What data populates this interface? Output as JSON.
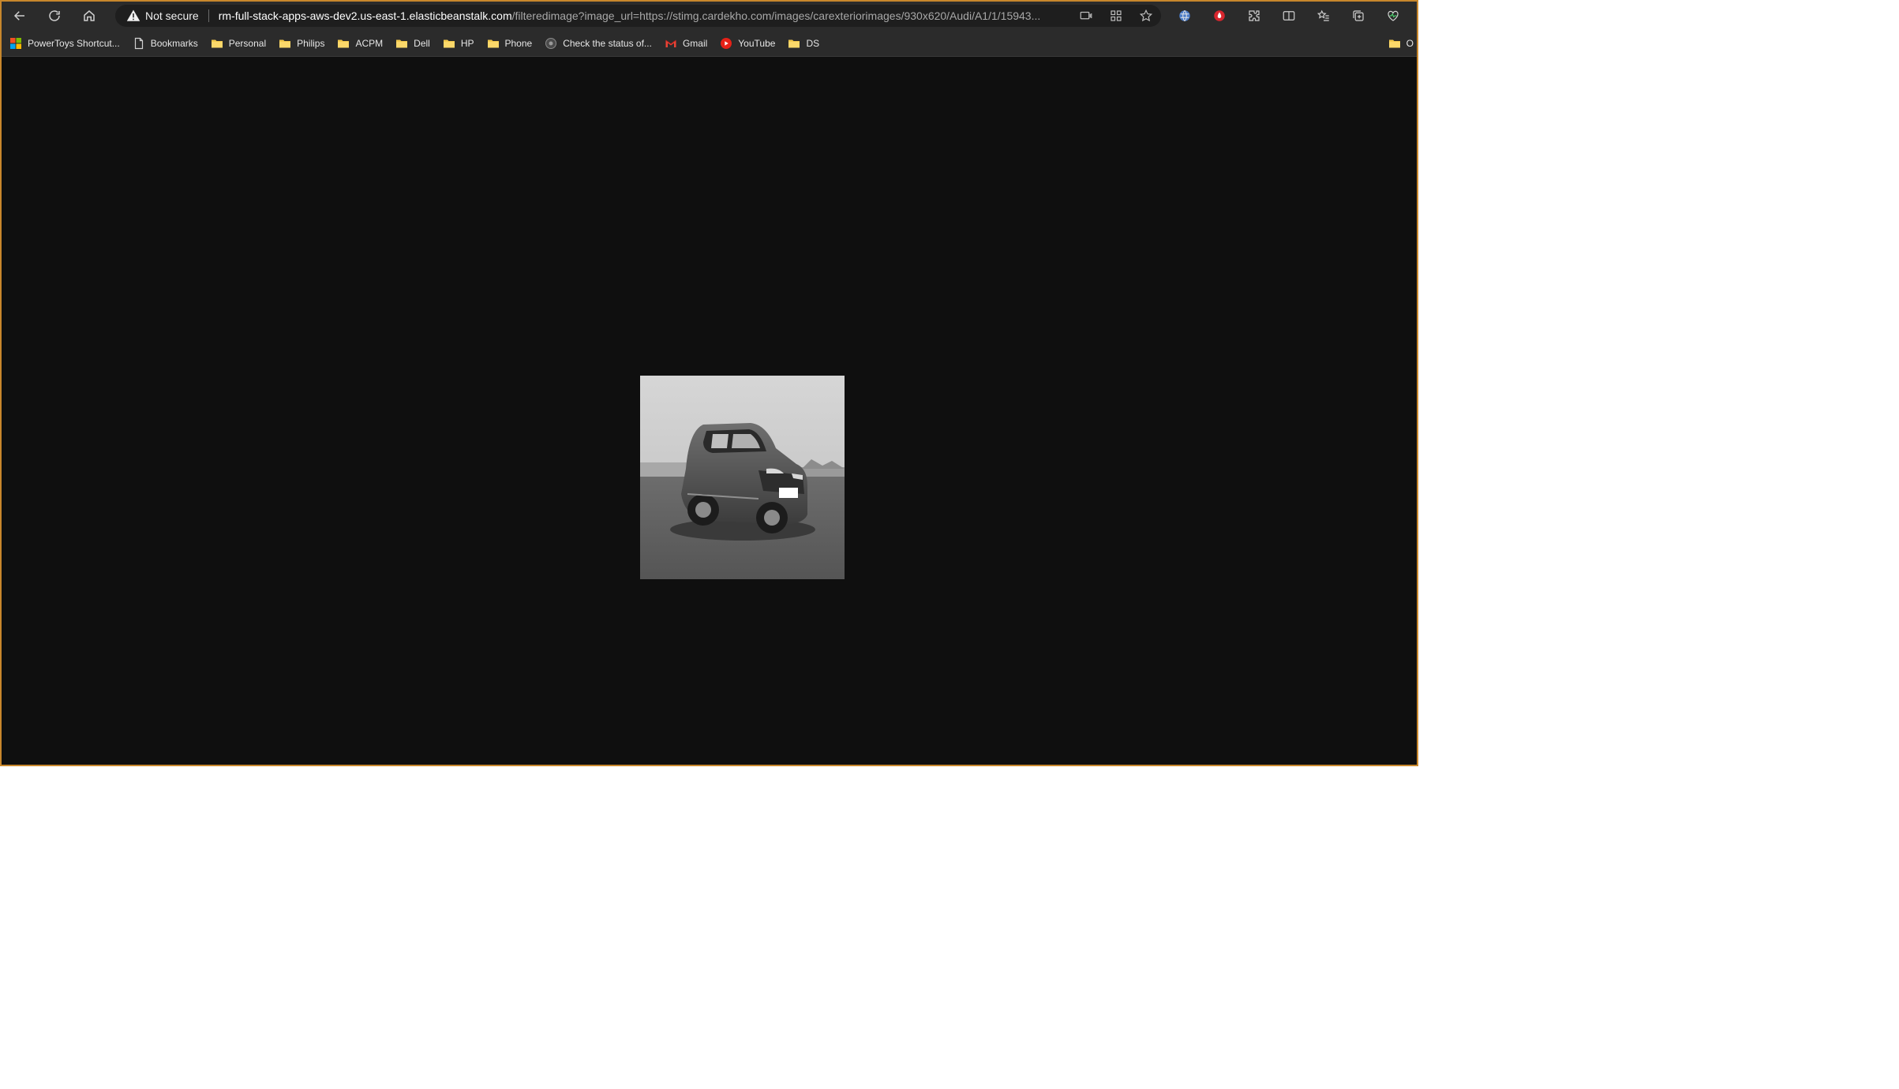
{
  "window": {
    "border_color": "#c8872c"
  },
  "toolbar": {
    "back_icon": "arrow-left-icon",
    "reload_icon": "reload-icon",
    "home_icon": "home-icon"
  },
  "omnibox": {
    "security_label": "Not secure",
    "security_icon": "warning-triangle-icon",
    "url_host": "rm-full-stack-apps-aws-dev2.us-east-1.elasticbeanstalk.com",
    "url_rest": "/filteredimage?image_url=https://stimg.cardekho.com/images/carexteriorimages/930x620/Audi/A1/1/15943...",
    "icons": [
      "read-aloud-icon",
      "apps-icon",
      "star-icon"
    ]
  },
  "extensions": {
    "icons": [
      "globe-extension-icon",
      "red-extension-icon",
      "puzzle-icon",
      "split-screen-icon",
      "favorites-icon",
      "collections-icon",
      "heart-pulse-icon"
    ]
  },
  "bookmarks": {
    "items": [
      {
        "label": "PowerToys Shortcut...",
        "icon": "windows-logo-icon"
      },
      {
        "label": "Bookmarks",
        "icon": "page-icon"
      },
      {
        "label": "Personal",
        "icon": "folder-icon"
      },
      {
        "label": "Philips",
        "icon": "folder-icon"
      },
      {
        "label": "ACPM",
        "icon": "folder-icon"
      },
      {
        "label": "Dell",
        "icon": "folder-icon"
      },
      {
        "label": "HP",
        "icon": "folder-icon"
      },
      {
        "label": "Phone",
        "icon": "folder-icon"
      },
      {
        "label": "Check the status of...",
        "icon": "globe-icon"
      },
      {
        "label": "Gmail",
        "icon": "gmail-icon"
      },
      {
        "label": "YouTube",
        "icon": "youtube-icon"
      },
      {
        "label": "DS",
        "icon": "folder-icon"
      }
    ],
    "overflow_label": "O"
  },
  "content": {
    "background": "#0f0f0f",
    "image_description": "grayscale-car-photo"
  }
}
